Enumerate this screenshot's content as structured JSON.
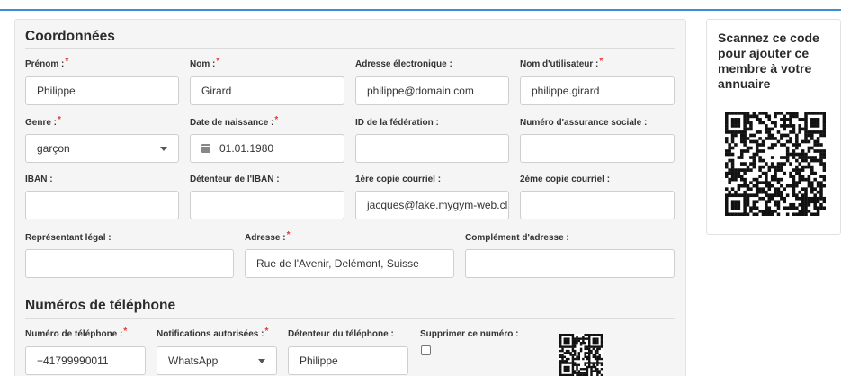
{
  "coordonnees": {
    "title": "Coordonnées",
    "prenom_label": "Prénom :",
    "prenom_value": "Philippe",
    "nom_label": "Nom :",
    "nom_value": "Girard",
    "email_label": "Adresse électronique :",
    "email_value": "philippe@domain.com",
    "username_label": "Nom d'utilisateur :",
    "username_value": "philippe.girard",
    "genre_label": "Genre :",
    "genre_value": "garçon",
    "dob_label": "Date de naissance :",
    "dob_value": "01.01.1980",
    "federation_label": "ID de la fédération :",
    "federation_value": "",
    "avs_label": "Numéro d'assurance sociale :",
    "avs_value": "",
    "iban_label": "IBAN :",
    "iban_value": "",
    "iban_holder_label": "Détenteur de l'IBAN :",
    "iban_holder_value": "",
    "copy1_label": "1ère copie courriel :",
    "copy1_value": "jacques@fake.mygym-web.cl",
    "copy2_label": "2ème copie courriel :",
    "copy2_value": "",
    "legal_rep_label": "Représentant légal :",
    "legal_rep_value": "",
    "address_label": "Adresse :",
    "address_value": "Rue de l'Avenir, Delémont, Suisse",
    "address2_label": "Complément d'adresse :",
    "address2_value": ""
  },
  "phones": {
    "title": "Numéros de téléphone",
    "number_label": "Numéro de téléphone :",
    "number_value": "+41799990011",
    "notif_label": "Notifications autorisées :",
    "notif_value": "WhatsApp",
    "holder_label": "Détenteur du téléphone :",
    "holder_value": "Philippe",
    "delete_label": "Supprimer ce numéro :"
  },
  "sidebar": {
    "qr_text": "Scannez ce code pour ajouter ce membre à votre annuaire"
  },
  "colors": {
    "accent": "#3b8ed8",
    "required": "#e53935"
  }
}
